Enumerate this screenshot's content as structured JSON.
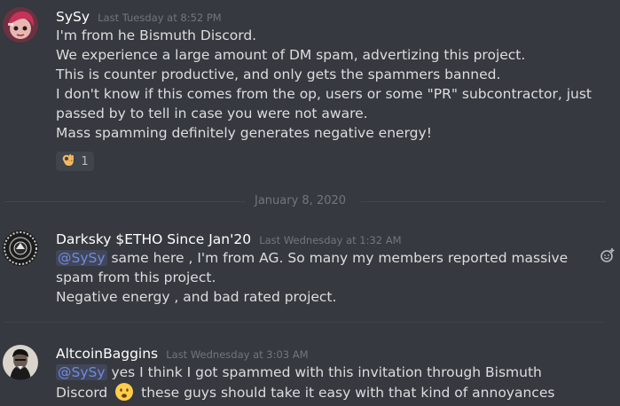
{
  "messages": [
    {
      "username": "SySy",
      "timestamp": "Last Tuesday at 8:52 PM",
      "lines": [
        "I'm from he Bismuth Discord.",
        "We experience a large amount of DM spam, advertizing this project.",
        "This is counter productive, and only gets the spammers banned.",
        "I don't know if this comes from the op, users or some \"PR\" subcontractor, just",
        "passed by to tell in case you were not aware.",
        "Mass spamming definitely generates negative energy!"
      ],
      "reaction": {
        "emoji": "ok-hand",
        "count": "1"
      }
    },
    {
      "username": "Darksky $ETHO Since Jan'20",
      "timestamp": "Last Wednesday at 1:32 AM",
      "mention": "@SySy",
      "lines": [
        "same here , I'm from AG. So many my members reported massive",
        "spam from this project.",
        "Negative energy , and bad rated project."
      ]
    },
    {
      "username": "AltcoinBaggins",
      "timestamp": "Last Wednesday at 3:03 AM",
      "mention": "@SySy",
      "lines": [
        "yes I think I got spammed with this invitation through Bismuth",
        "Discord",
        "these guys should take it easy with that kind of annoyances"
      ],
      "inline_emoji": "frowning-face"
    }
  ],
  "date_divider": "January 8, 2020",
  "colors": {
    "background": "#36393f",
    "text": "#dcddde",
    "username": "#ffffff",
    "timestamp": "#72767d",
    "mention": "#7289da"
  }
}
